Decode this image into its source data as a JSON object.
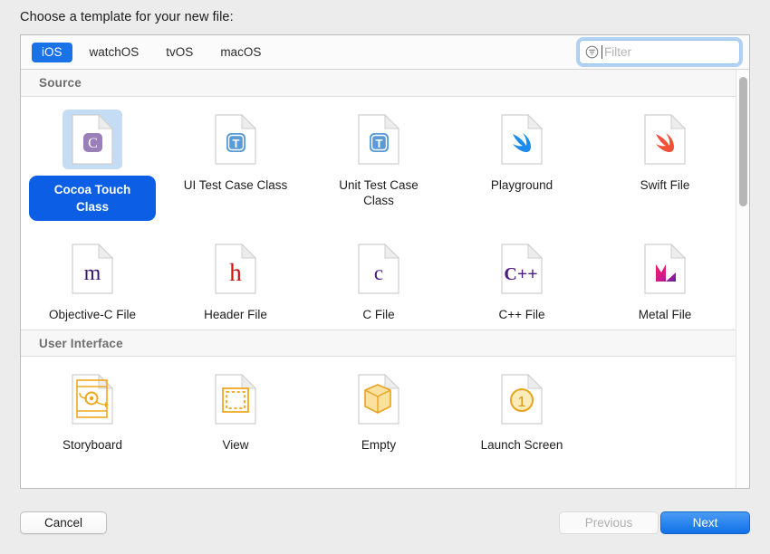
{
  "dialog": {
    "prompt": "Choose a template for your new file:"
  },
  "tabs": [
    {
      "label": "iOS",
      "selected": true
    },
    {
      "label": "watchOS",
      "selected": false
    },
    {
      "label": "tvOS",
      "selected": false
    },
    {
      "label": "macOS",
      "selected": false
    }
  ],
  "filter": {
    "placeholder": "Filter",
    "value": "",
    "icon": "filter-funnel-icon",
    "focused": true
  },
  "sections": [
    {
      "title": "Source",
      "items": [
        {
          "label": "Cocoa Touch Class",
          "icon": "cocoa-touch-class-icon",
          "badge": "C",
          "badge_color": "#9a7fb8",
          "selected": true
        },
        {
          "label": "UI Test Case Class",
          "icon": "ui-test-case-class-icon",
          "badge": "T",
          "badge_color": "#4a90d9",
          "selected": false
        },
        {
          "label": "Unit Test Case Class",
          "icon": "unit-test-case-class-icon",
          "badge": "T",
          "badge_color": "#4a90d9",
          "selected": false
        },
        {
          "label": "Playground",
          "icon": "playground-swift-icon",
          "badge": "",
          "badge_color": "#1b8ced",
          "selected": false
        },
        {
          "label": "Swift File",
          "icon": "swift-file-icon",
          "badge": "",
          "badge_color": "#f05138",
          "selected": false
        },
        {
          "label": "Objective-C File",
          "icon": "objective-c-file-icon",
          "badge": "m",
          "badge_color": "#3b1a7a",
          "selected": false
        },
        {
          "label": "Header File",
          "icon": "header-file-icon",
          "badge": "h",
          "badge_color": "#cc1111",
          "selected": false
        },
        {
          "label": "C File",
          "icon": "c-file-icon",
          "badge": "c",
          "badge_color": "#4b1b82",
          "selected": false
        },
        {
          "label": "C++ File",
          "icon": "cpp-file-icon",
          "badge": "C++",
          "badge_color": "#4b1b82",
          "selected": false
        },
        {
          "label": "Metal File",
          "icon": "metal-file-icon",
          "badge": "M",
          "badge_color": "#e3197f",
          "selected": false
        }
      ]
    },
    {
      "title": "User Interface",
      "items": [
        {
          "label": "Storyboard",
          "icon": "storyboard-icon",
          "badge": "",
          "badge_color": "#f0a81e",
          "selected": false
        },
        {
          "label": "View",
          "icon": "view-icon",
          "badge": "",
          "badge_color": "#f0a81e",
          "selected": false
        },
        {
          "label": "Empty",
          "icon": "empty-cube-icon",
          "badge": "",
          "badge_color": "#f0a81e",
          "selected": false
        },
        {
          "label": "Launch Screen",
          "icon": "launch-screen-icon",
          "badge": "1",
          "badge_color": "#f0a81e",
          "selected": false
        }
      ]
    }
  ],
  "footer": {
    "cancel": "Cancel",
    "previous": "Previous",
    "next": "Next"
  },
  "colors": {
    "accent": "#1a72e8",
    "selection": "#0c5fe4",
    "selection_tint": "#c5dcf5",
    "panel_bg": "#ffffff",
    "window_bg": "#ececec"
  }
}
